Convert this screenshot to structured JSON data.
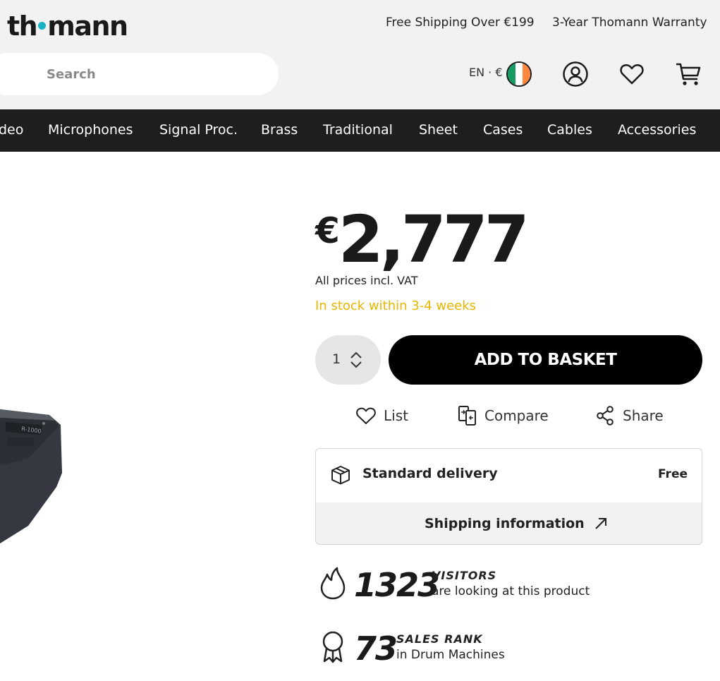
{
  "header": {
    "logo_left": "th",
    "logo_right": "mann",
    "usps": [
      "Free Shipping Over €199",
      "3-Year Thomann Warranty"
    ],
    "search_placeholder": "Search",
    "language_currency": "EN · €",
    "flag_colors": [
      "#169b62",
      "#ffffff",
      "#ff883e"
    ],
    "icons": [
      "account-icon",
      "wishlist-icon",
      "cart-icon"
    ]
  },
  "nav": {
    "items": [
      "deo",
      "Microphones",
      "Signal Proc.",
      "Brass",
      "Traditional",
      "Sheet",
      "Cases",
      "Cables",
      "Accessories"
    ]
  },
  "product": {
    "currency_symbol": "€",
    "price": "2,777",
    "vat_note": "All prices incl. VAT",
    "stock_status": "In stock within 3-4 weeks",
    "stock_color": "#e8b600",
    "quantity": "1",
    "add_to_basket": "ADD TO BASKET",
    "actions": {
      "list": "List",
      "compare": "Compare",
      "share": "Share"
    },
    "delivery": {
      "title": "Standard delivery",
      "price": "Free",
      "shipping_info": "Shipping information"
    },
    "stats": {
      "visitors_count": "1323",
      "visitors_label": "VISITORS",
      "visitors_sub": "are looking at this product",
      "sales_rank": "73",
      "sales_rank_label": "SALES RANK",
      "sales_rank_sub": "in Drum Machines"
    }
  }
}
